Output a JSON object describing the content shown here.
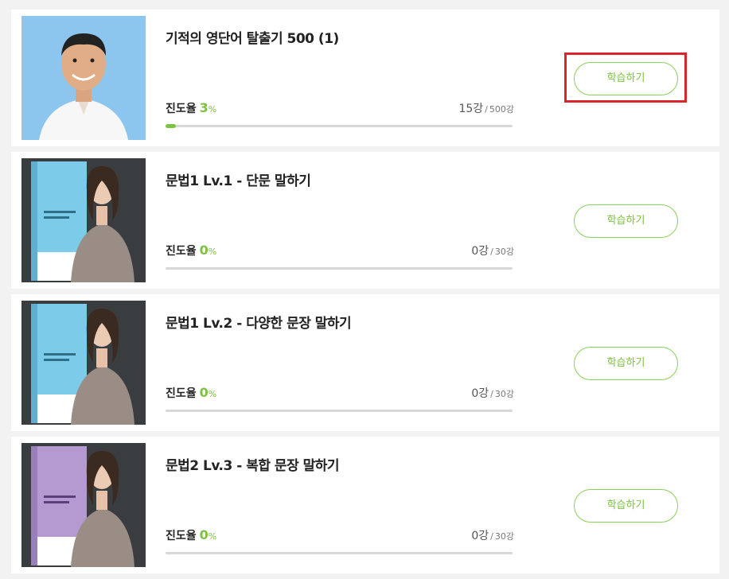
{
  "courses": [
    {
      "title": "기적의 영단어 탈출기 500 (1)",
      "progress_label": "진도율",
      "progress_percent": "3",
      "progress_unit": "%",
      "progress_fraction": 0.03,
      "done": "15강",
      "separator": "/",
      "total": "500강",
      "button": "학습하기",
      "thumb": "instructor-photo"
    },
    {
      "title": "문법1 Lv.1 - 단문 말하기",
      "progress_label": "진도율",
      "progress_percent": "0",
      "progress_unit": "%",
      "progress_fraction": 0.0,
      "done": "0강",
      "separator": "/",
      "total": "30강",
      "button": "학습하기",
      "thumb": "book-cover-blue"
    },
    {
      "title": "문법1 Lv.2 - 다양한 문장 말하기",
      "progress_label": "진도율",
      "progress_percent": "0",
      "progress_unit": "%",
      "progress_fraction": 0.0,
      "done": "0강",
      "separator": "/",
      "total": "30강",
      "button": "학습하기",
      "thumb": "book-cover-blue"
    },
    {
      "title": "문법2 Lv.3 - 복합 문장 말하기",
      "progress_label": "진도율",
      "progress_percent": "0",
      "progress_unit": "%",
      "progress_fraction": 0.0,
      "done": "0강",
      "separator": "/",
      "total": "30강",
      "button": "학습하기",
      "thumb": "book-cover-purple"
    }
  ],
  "colors": {
    "accent": "#7cc242",
    "highlight": "#d9262c"
  }
}
